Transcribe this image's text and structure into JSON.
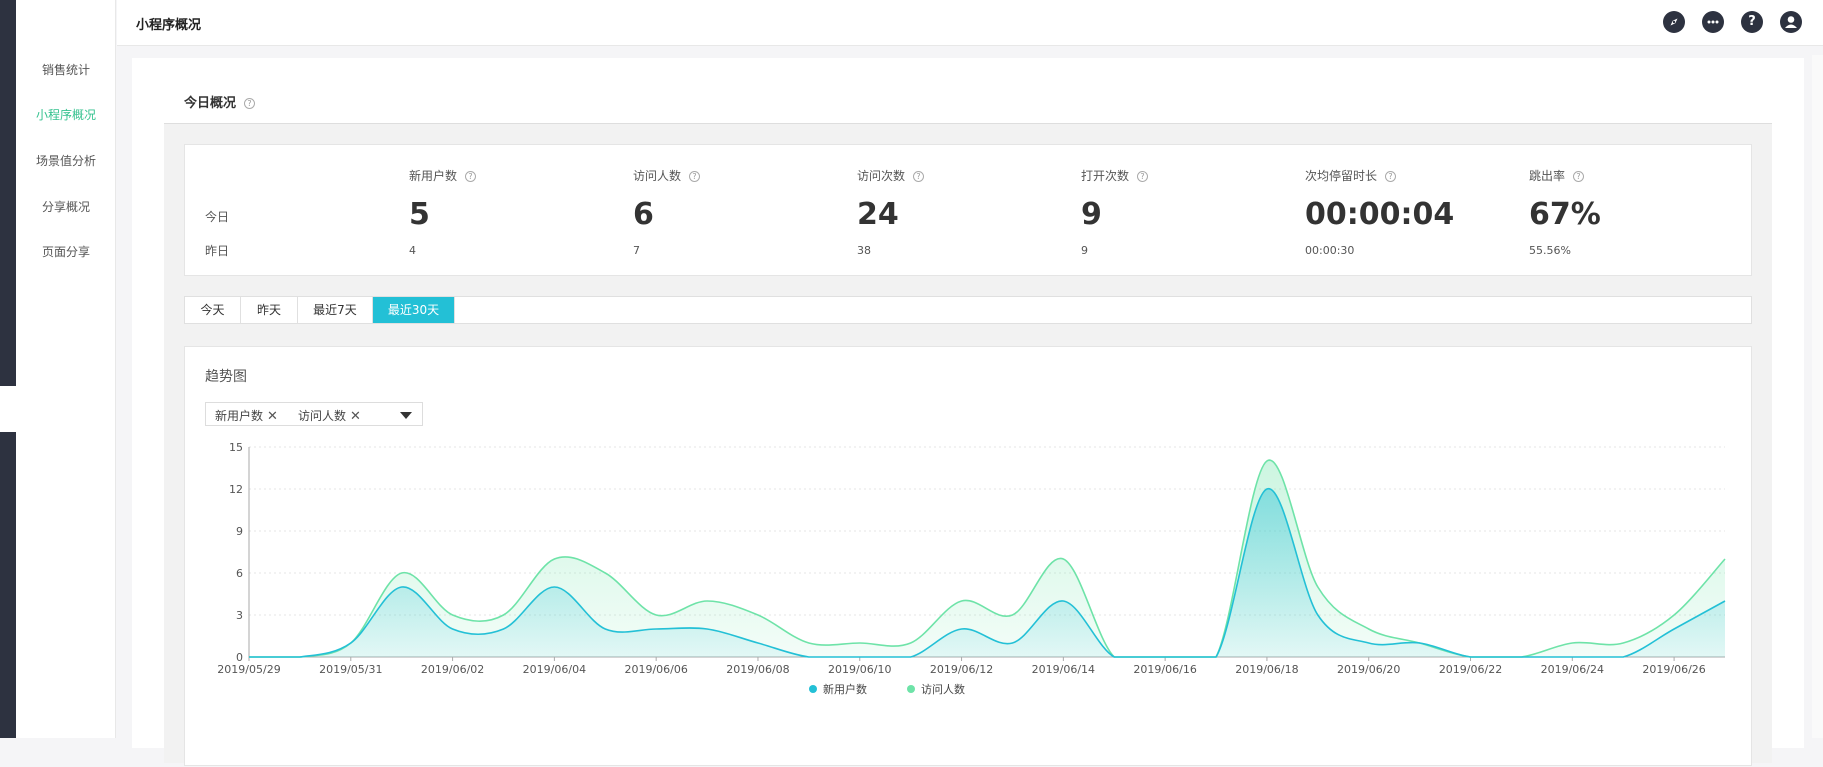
{
  "sidebar": {
    "items": [
      {
        "label": "销售统计",
        "active": false
      },
      {
        "label": "小程序概况",
        "active": true
      },
      {
        "label": "场景值分析",
        "active": false
      },
      {
        "label": "分享概况",
        "active": false
      },
      {
        "label": "页面分享",
        "active": false
      }
    ]
  },
  "header": {
    "title": "小程序概况",
    "icons": [
      "compass-icon",
      "chat-icon",
      "help-icon",
      "user-icon"
    ]
  },
  "overview": {
    "title": "今日概况",
    "help": "?",
    "row_today": "今日",
    "row_yesterday": "昨日",
    "metrics": [
      {
        "label": "新用户数",
        "today": "5",
        "yesterday": "4"
      },
      {
        "label": "访问人数",
        "today": "6",
        "yesterday": "7"
      },
      {
        "label": "访问次数",
        "today": "24",
        "yesterday": "38"
      },
      {
        "label": "打开次数",
        "today": "9",
        "yesterday": "9"
      },
      {
        "label": "次均停留时长",
        "today": "00:00:04",
        "yesterday": "00:00:30"
      },
      {
        "label": "跳出率",
        "today": "67%",
        "yesterday": "55.56%"
      }
    ]
  },
  "tabs": [
    {
      "label": "今天",
      "active": false
    },
    {
      "label": "昨天",
      "active": false
    },
    {
      "label": "最近7天",
      "active": false
    },
    {
      "label": "最近30天",
      "active": true
    }
  ],
  "trend": {
    "title": "趋势图",
    "selected_series": [
      "新用户数",
      "访问人数"
    ],
    "remove_symbol": "✕"
  },
  "colors": {
    "accent": "#35c28f",
    "tab_active": "#23c0d6",
    "series_new_users": "#23c0d6",
    "series_visitors": "#6ee3a8"
  },
  "chart_data": {
    "type": "area",
    "x": [
      "2019/05/29",
      "2019/05/30",
      "2019/05/31",
      "2019/06/01",
      "2019/06/02",
      "2019/06/03",
      "2019/06/04",
      "2019/06/05",
      "2019/06/06",
      "2019/06/07",
      "2019/06/08",
      "2019/06/09",
      "2019/06/10",
      "2019/06/11",
      "2019/06/12",
      "2019/06/13",
      "2019/06/14",
      "2019/06/15",
      "2019/06/16",
      "2019/06/17",
      "2019/06/18",
      "2019/06/19",
      "2019/06/20",
      "2019/06/21",
      "2019/06/22",
      "2019/06/23",
      "2019/06/24",
      "2019/06/25",
      "2019/06/26",
      "2019/06/27"
    ],
    "x_tick_labels": [
      "2019/05/29",
      "2019/05/31",
      "2019/06/02",
      "2019/06/04",
      "2019/06/06",
      "2019/06/08",
      "2019/06/10",
      "2019/06/12",
      "2019/06/14",
      "2019/06/16",
      "2019/06/18",
      "2019/06/20",
      "2019/06/22",
      "2019/06/24",
      "2019/06/26"
    ],
    "series": [
      {
        "name": "新用户数",
        "values": [
          0,
          0,
          1,
          5,
          2,
          2,
          5,
          2,
          2,
          2,
          1,
          0,
          0,
          0,
          2,
          1,
          4,
          0,
          0,
          0,
          12,
          3,
          1,
          1,
          0,
          0,
          0,
          0,
          2,
          4
        ]
      },
      {
        "name": "访问人数",
        "values": [
          0,
          0,
          1,
          6,
          3,
          3,
          7,
          6,
          3,
          4,
          3,
          1,
          1,
          1,
          4,
          3,
          7,
          0,
          0,
          0,
          14,
          5,
          2,
          1,
          0,
          0,
          1,
          1,
          3,
          7
        ]
      }
    ],
    "ylim": [
      0,
      15
    ],
    "yticks": [
      0,
      3,
      6,
      9,
      12,
      15
    ],
    "grid": true,
    "legend": "bottom-center"
  }
}
